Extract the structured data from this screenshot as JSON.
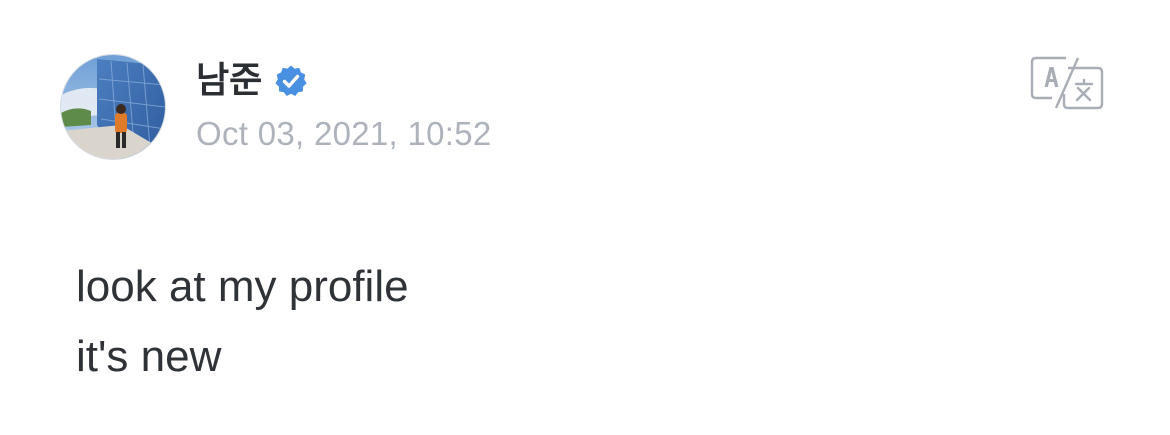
{
  "post": {
    "author": {
      "name": "남준",
      "verified": true,
      "avatar_icon": "profile-photo"
    },
    "timestamp": "Oct 03, 2021, 10:52",
    "translate_icon": "translate-icon",
    "content_lines": [
      "look at my profile",
      "it's new"
    ]
  },
  "colors": {
    "verified_badge": "#4a90e2",
    "name_text": "#2b2e33",
    "timestamp_text": "#aeb3bb",
    "body_text": "#2f3338",
    "icon_stroke": "#a9aeb6"
  }
}
